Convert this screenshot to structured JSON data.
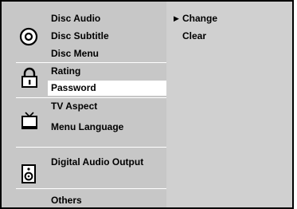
{
  "menu": {
    "groups": [
      {
        "icon": "disc-icon",
        "items": [
          "Disc Audio",
          "Disc Subtitle",
          "Disc Menu"
        ]
      },
      {
        "icon": "padlock-icon",
        "items": [
          "Rating",
          "Password"
        ]
      },
      {
        "icon": "tv-icon",
        "items": [
          "TV Aspect",
          "Menu Language"
        ]
      },
      {
        "icon": "speaker-icon",
        "items": [
          "Digital Audio Output"
        ]
      },
      {
        "icon": "none",
        "items": [
          "Others"
        ]
      }
    ],
    "selected_item": "Password"
  },
  "submenu": {
    "pointer": "▶",
    "options": [
      "Change",
      "Clear"
    ]
  },
  "colors": {
    "left_panel": "#c7c7c7",
    "right_panel": "#d0d0d0",
    "highlight": "#ffffff",
    "text": "#000000"
  }
}
